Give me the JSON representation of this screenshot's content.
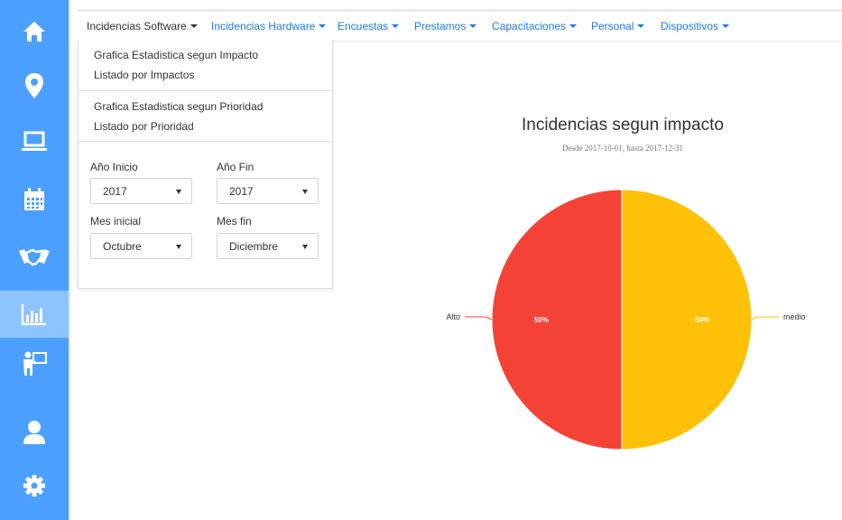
{
  "sidebar": {
    "items": [
      {
        "icon": "home-icon",
        "active": false
      },
      {
        "icon": "map-marker-icon",
        "active": false
      },
      {
        "icon": "laptop-icon",
        "active": false
      },
      {
        "icon": "calendar-icon",
        "active": false
      },
      {
        "icon": "handshake-icon",
        "active": false
      },
      {
        "icon": "bar-chart-icon",
        "active": true
      },
      {
        "icon": "teacher-icon",
        "active": false
      },
      {
        "icon": "user-icon",
        "active": false
      },
      {
        "icon": "gear-icon",
        "active": false
      }
    ],
    "color": "#4ba0ff",
    "active_color": "#8cc4ff"
  },
  "nav": {
    "items": [
      {
        "label": "Incidencias Software"
      },
      {
        "label": "Incidencias Hardware"
      },
      {
        "label": "Encuestas"
      },
      {
        "label": "Prestamos"
      },
      {
        "label": "Capacitaciones"
      },
      {
        "label": "Personal"
      },
      {
        "label": "Dispositivos"
      }
    ]
  },
  "dropdown": {
    "links": [
      "Grafica Estadistica segun Impacto",
      "Listado por Impactos",
      "Grafica Estadistica segun Prioridad",
      "Listado por Prioridad"
    ],
    "filters": {
      "year_start_label": "Año Inicio",
      "year_start_value": "2017",
      "year_end_label": "Año Fin",
      "year_end_value": "2017",
      "month_start_label": "Mes inicial",
      "month_start_value": "Octubre",
      "month_end_label": "Mes fin",
      "month_end_value": "Diciembre"
    }
  },
  "chart_data": {
    "type": "pie",
    "title": "Incidencias segun impacto",
    "subtitle": "Desde 2017-10-01, hasta 2017-12-31",
    "slices": [
      {
        "name": "medio",
        "value": 50,
        "label": "50%",
        "color": "#ffc107"
      },
      {
        "name": "Alto",
        "value": 50,
        "label": "50%",
        "color": "#f44336"
      }
    ]
  }
}
